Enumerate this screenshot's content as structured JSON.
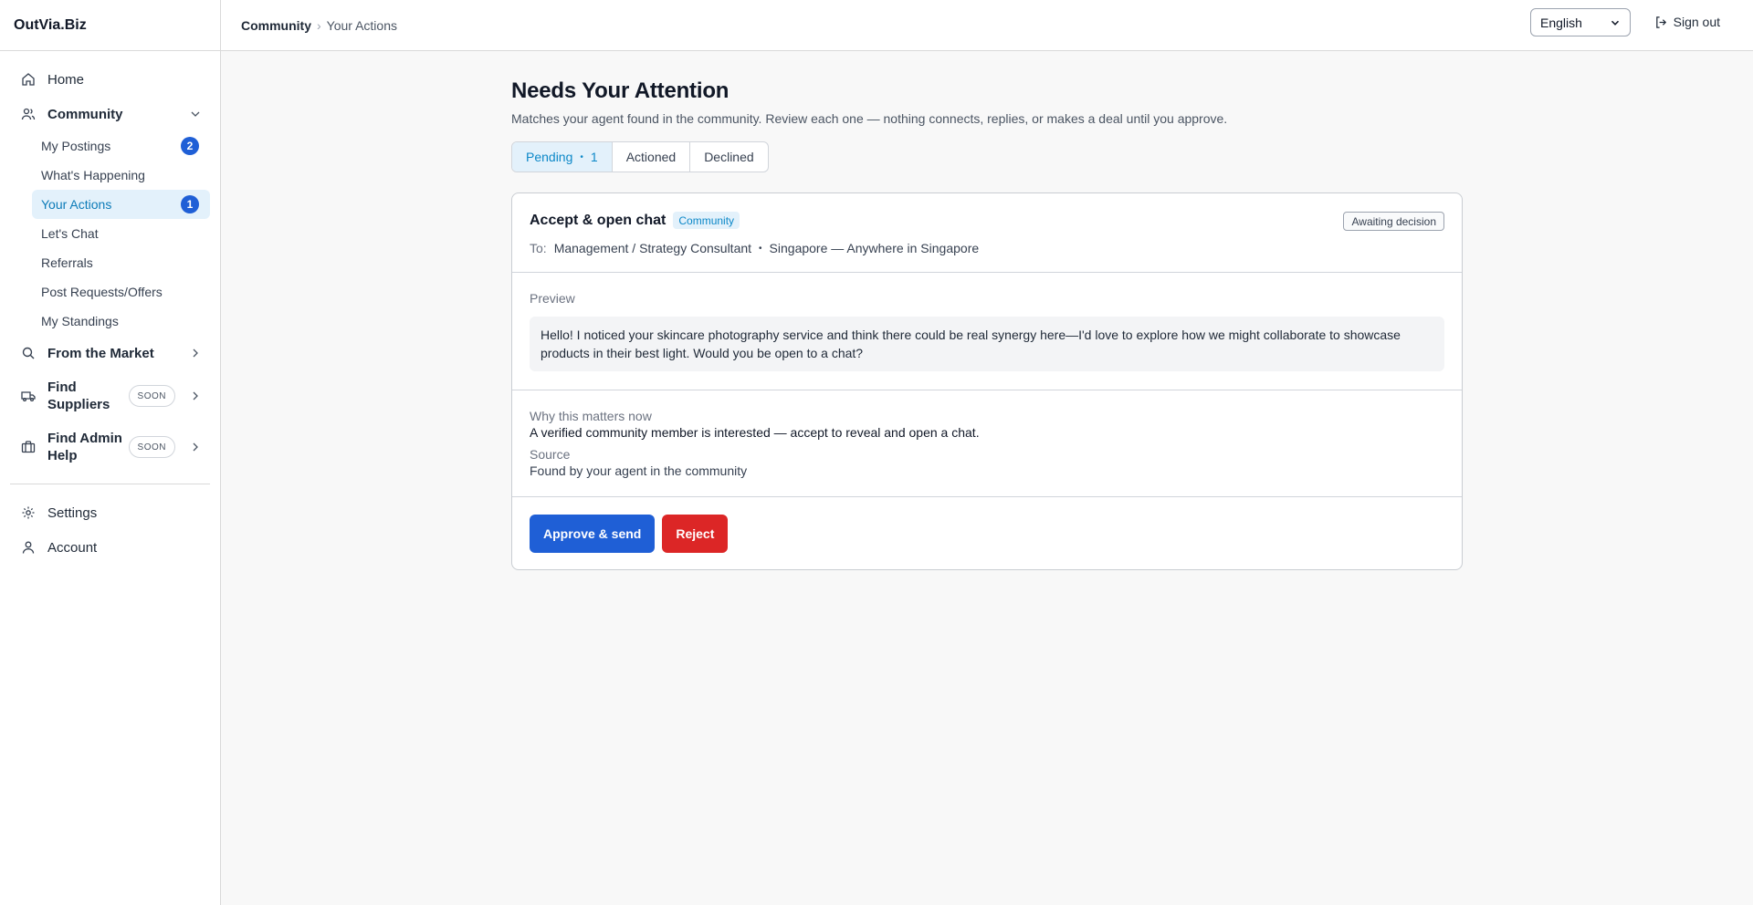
{
  "app": {
    "brand": "OutVia.Biz"
  },
  "sidebar": {
    "home": "Home",
    "community": "Community",
    "community_items": [
      {
        "label": "My Postings",
        "badge": "2"
      },
      {
        "label": "What's Happening"
      },
      {
        "label": "Your Actions",
        "badge": "1"
      },
      {
        "label": "Let's Chat"
      },
      {
        "label": "Referrals"
      },
      {
        "label": "Post Requests/Offers"
      },
      {
        "label": "My Standings"
      }
    ],
    "from_market": "From the Market",
    "find_suppliers": "Find Suppliers",
    "find_admin_help": "Find Admin Help",
    "soon": "SOON",
    "settings": "Settings",
    "account": "Account"
  },
  "topbar": {
    "breadcrumb": {
      "parent": "Community",
      "current": "Your Actions"
    },
    "language": "English",
    "signout": "Sign out"
  },
  "page": {
    "title": "Needs Your Attention",
    "subtitle": "Matches your agent found in the community. Review each one — nothing connects, replies, or makes a deal until you approve.",
    "tabs": {
      "pending": "Pending",
      "pending_dot": "•",
      "pending_count": "1",
      "actioned": "Actioned",
      "declined": "Declined"
    }
  },
  "card": {
    "title": "Accept & open chat",
    "tag": "Community",
    "status": "Awaiting decision",
    "to_label": "To:",
    "to_role": "Management / Strategy Consultant",
    "to_dot": "•",
    "to_location": "Singapore — Anywhere in Singapore",
    "preview_label": "Preview",
    "preview_text": "Hello! I noticed your skincare photography service and think there could be real synergy here—I'd love to explore how we might collaborate to showcase products in their best light. Would you be open to a chat?",
    "why_label": "Why this matters now",
    "why_text": "A verified community member is interested — accept to reveal and open a chat.",
    "source_label": "Source",
    "source_text": "Found by your agent in the community",
    "approve_label": "Approve & send",
    "reject_label": "Reject"
  },
  "colors": {
    "accent": "#1f5fd6",
    "active_bg": "#e3f1fb",
    "active_text": "#0c7bb8",
    "danger": "#dc2626"
  }
}
